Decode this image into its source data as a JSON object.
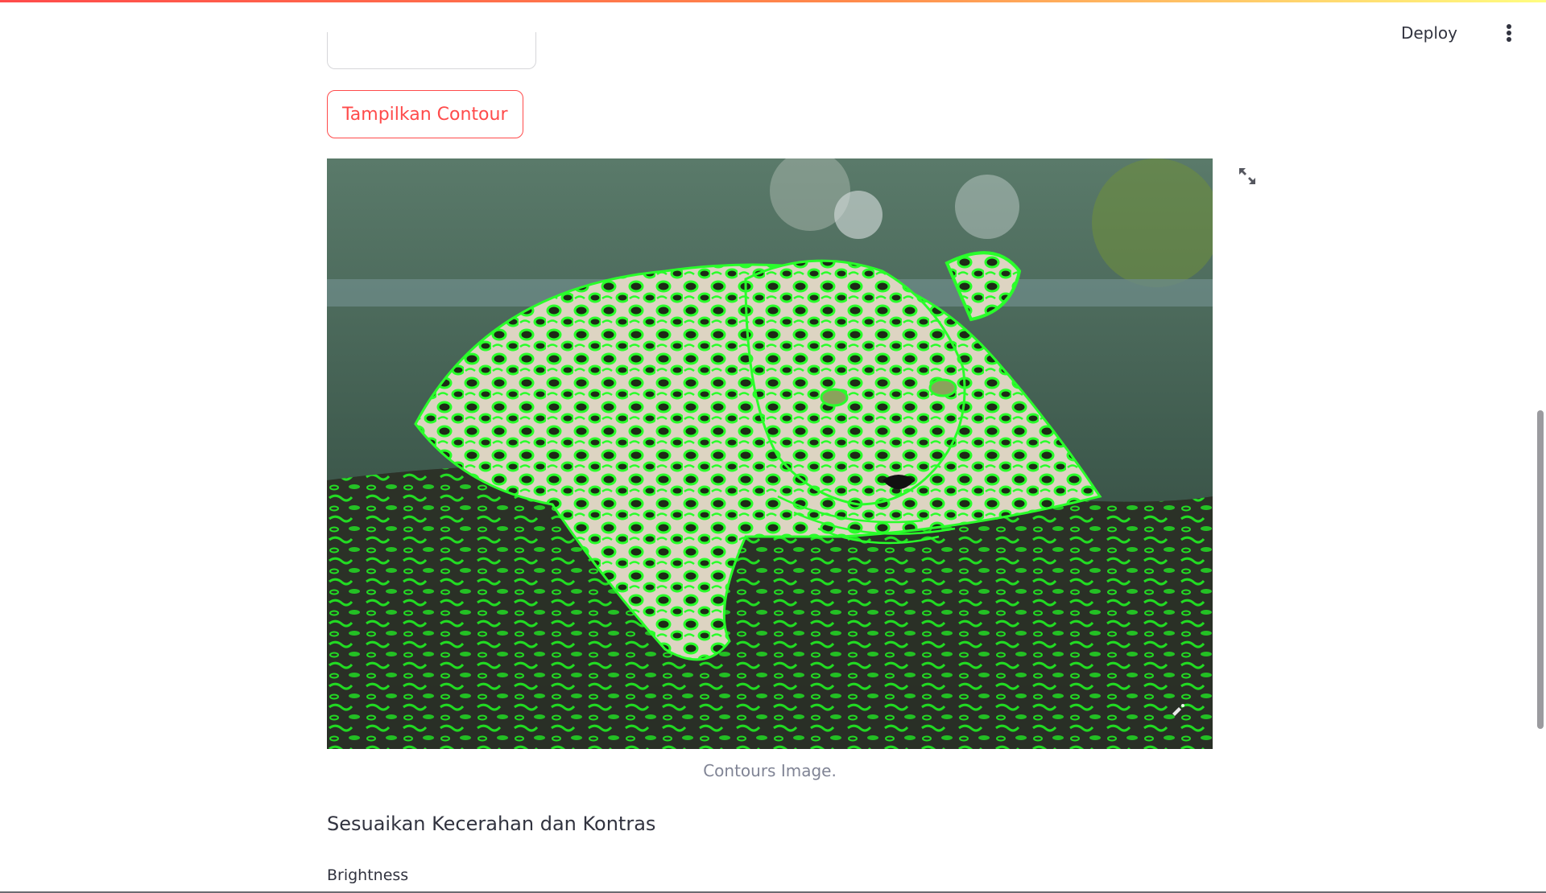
{
  "header": {
    "deploy_label": "Deploy",
    "menu_icon": "more-vertical-icon"
  },
  "main": {
    "contour_button_label": "Tampilkan Contour",
    "image": {
      "subject": "leopard-contours",
      "contour_color": "#00ff00",
      "caption": "Contours Image."
    },
    "section_heading": "Sesuaikan Kecerahan dan Kontras",
    "slider_label": "Brightness"
  },
  "colors": {
    "accent": "#ff4b4b",
    "text": "#31333f",
    "caption": "#808495"
  }
}
